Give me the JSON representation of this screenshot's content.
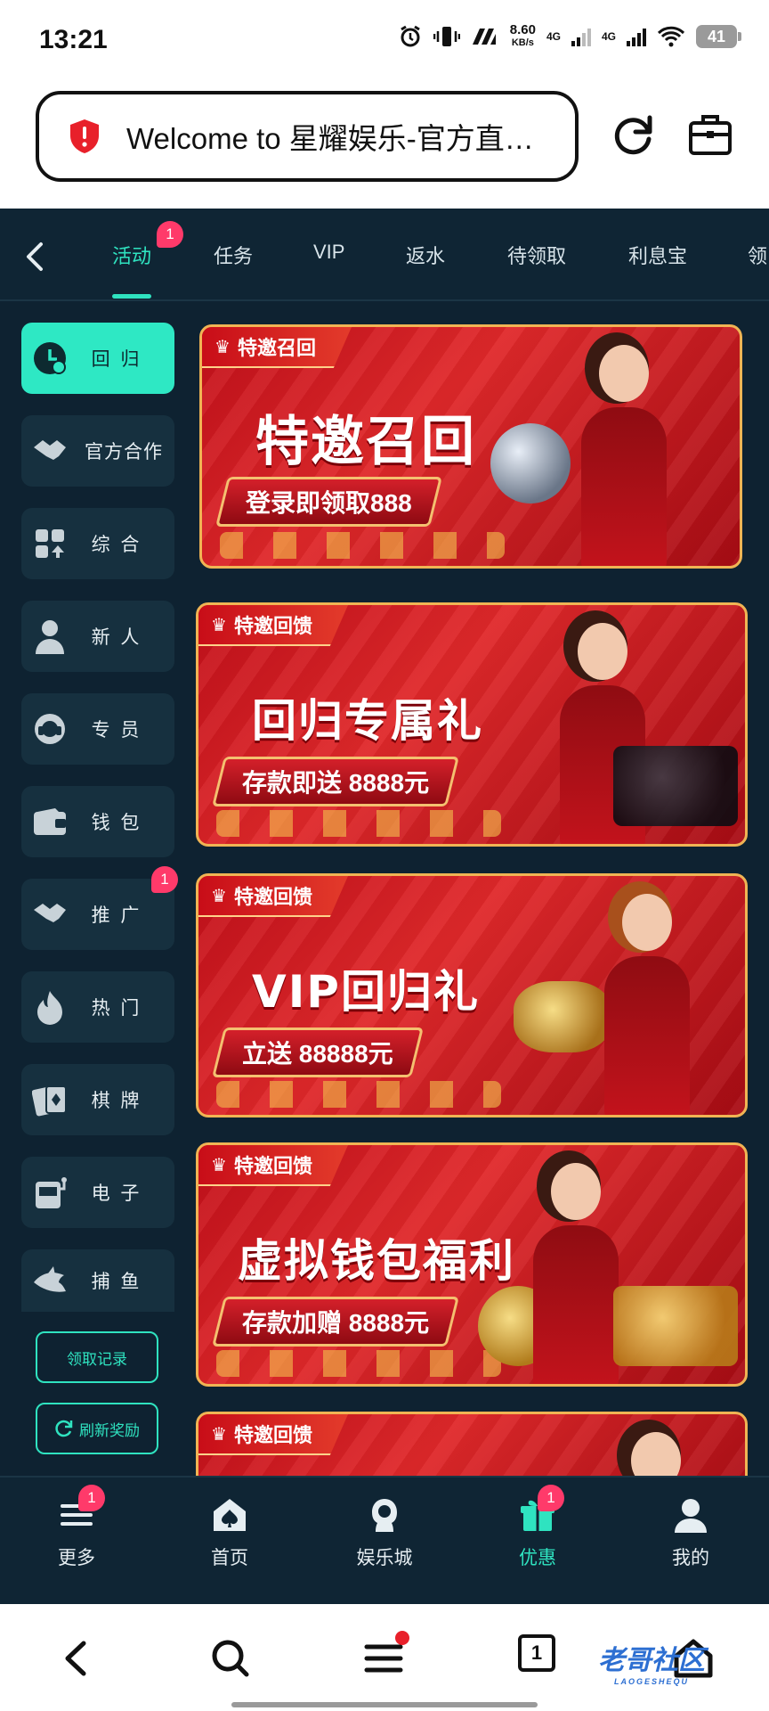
{
  "status_bar": {
    "time": "13:21",
    "speed_value": "8.60",
    "speed_unit": "KB/s",
    "net1": "4G",
    "net2": "4G",
    "battery": "41"
  },
  "browser": {
    "url_title": "Welcome to 星耀娱乐-官方直…"
  },
  "tabs": [
    {
      "label": "活动",
      "active": true,
      "badge": "1"
    },
    {
      "label": "任务"
    },
    {
      "label": "VIP"
    },
    {
      "label": "返水"
    },
    {
      "label": "待领取"
    },
    {
      "label": "利息宝"
    },
    {
      "label": "领"
    }
  ],
  "sidebar": {
    "items": [
      {
        "label": "回 归",
        "icon": "clock-dollar-icon",
        "active": true
      },
      {
        "label": "官方合作",
        "icon": "handshake-icon"
      },
      {
        "label": "综 合",
        "icon": "grid-icon"
      },
      {
        "label": "新 人",
        "icon": "person-icon"
      },
      {
        "label": "专 员",
        "icon": "headset-icon"
      },
      {
        "label": "钱 包",
        "icon": "wallet-icon"
      },
      {
        "label": "推 广",
        "icon": "handshake-icon",
        "badge": "1"
      },
      {
        "label": "热 门",
        "icon": "fire-icon"
      },
      {
        "label": "棋 牌",
        "icon": "cards-icon"
      },
      {
        "label": "电 子",
        "icon": "slot-machine-icon"
      },
      {
        "label": "捕 鱼",
        "icon": "shark-icon"
      }
    ],
    "claim_records": "领取记录",
    "refresh_rewards": "刷新奖励"
  },
  "banners": [
    {
      "tag": "特邀召回",
      "headline": "特邀召回",
      "subline": "登录即领取888"
    },
    {
      "tag": "特邀回馈",
      "headline": "回归专属礼",
      "subline": "存款即送 8888元"
    },
    {
      "tag": "特邀回馈",
      "headline": "VIP回归礼",
      "subline": "立送 88888元"
    },
    {
      "tag": "特邀回馈",
      "headline": "虚拟钱包福利",
      "subline": "存款加赠 8888元"
    },
    {
      "tag": "特邀回馈"
    }
  ],
  "bottom_nav": [
    {
      "label": "更多",
      "icon": "menu-icon",
      "badge": "1"
    },
    {
      "label": "首页",
      "icon": "home-spade-icon"
    },
    {
      "label": "娱乐城",
      "icon": "lady-icon"
    },
    {
      "label": "优惠",
      "icon": "gift-icon",
      "badge": "1",
      "active": true
    },
    {
      "label": "我的",
      "icon": "user-icon"
    }
  ],
  "system_nav": {
    "tab_count": "1",
    "watermark": "老哥社区",
    "watermark_sub": "LAOGESHEQU"
  },
  "colors": {
    "accent": "#2fe3c0",
    "background": "#0e2231",
    "badge": "#ff3a6a",
    "banner_red": "#c3101a"
  }
}
